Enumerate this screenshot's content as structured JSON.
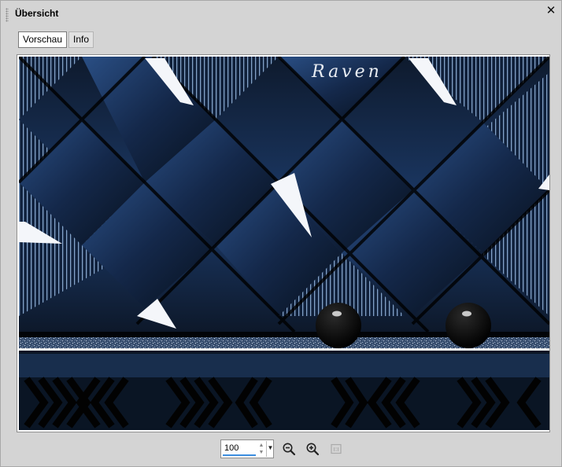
{
  "panel": {
    "title": "Übersicht",
    "close_symbol": "✕",
    "close_icon": "close-icon",
    "grip_icon": "drag-grip-icon"
  },
  "tabs": [
    {
      "label": "Vorschau",
      "active": true
    },
    {
      "label": "Info",
      "active": false
    }
  ],
  "preview": {
    "watermark": "Raven"
  },
  "zoom": {
    "value": "100",
    "dropdown_icon": "chevron-down-icon",
    "zoom_out_icon": "zoom-out-icon",
    "zoom_in_icon": "zoom-in-icon",
    "actual_size_icon": "actual-size-icon"
  }
}
